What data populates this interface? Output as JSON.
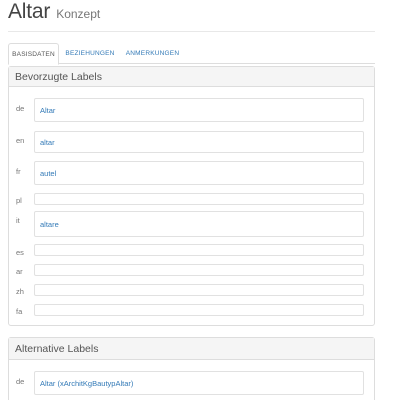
{
  "header": {
    "title": "Altar",
    "subtitle": "Konzept"
  },
  "tabs": [
    {
      "label": "BASISDATEN",
      "active": true
    },
    {
      "label": "BEZIEHUNGEN",
      "active": false
    },
    {
      "label": "ANMERKUNGEN",
      "active": false
    }
  ],
  "preferred_labels": {
    "heading": "Bevorzugte Labels",
    "rows": [
      {
        "lang": "de",
        "value": "Altar"
      },
      {
        "lang": "en",
        "value": "altar"
      },
      {
        "lang": "fr",
        "value": "autel"
      },
      {
        "lang": "pl",
        "value": ""
      },
      {
        "lang": "it",
        "value": "altare"
      },
      {
        "lang": "es",
        "value": ""
      },
      {
        "lang": "ar",
        "value": ""
      },
      {
        "lang": "zh",
        "value": ""
      },
      {
        "lang": "fa",
        "value": ""
      }
    ]
  },
  "alternative_labels": {
    "heading": "Alternative Labels",
    "rows": [
      {
        "lang": "de",
        "value": "Altar (xArchitKgBautypAltar)"
      }
    ]
  },
  "colors": {
    "link": "#337ab7",
    "panel_header_bg": "#f5f5f5",
    "border": "#dddddd"
  }
}
